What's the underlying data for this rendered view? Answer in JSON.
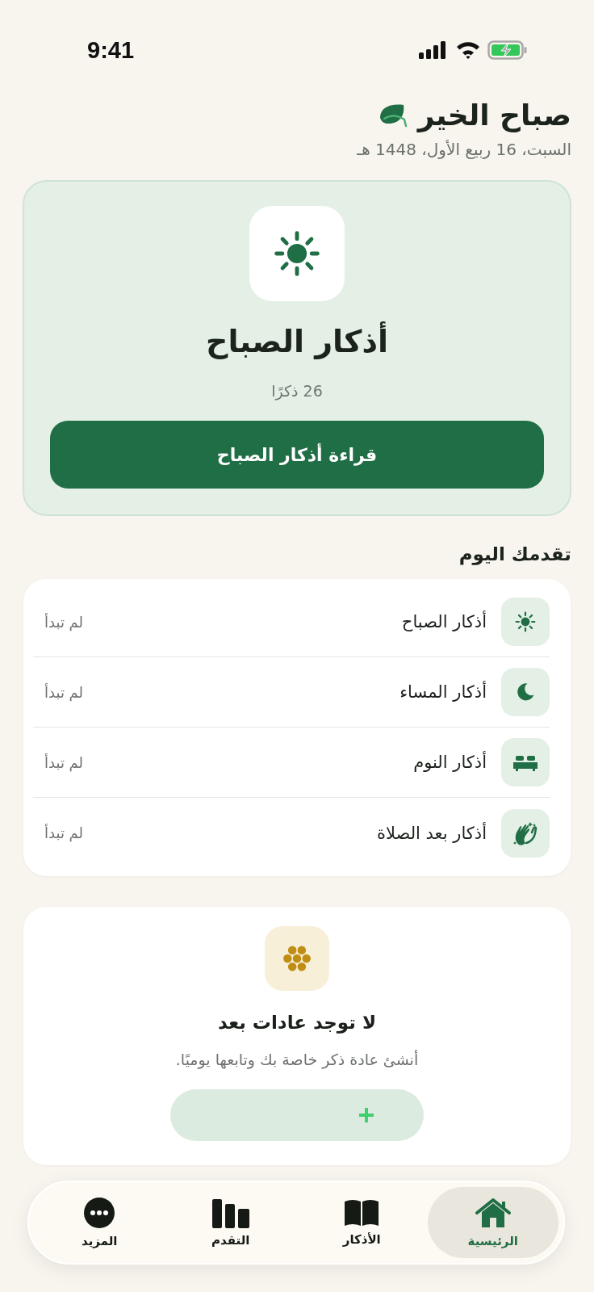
{
  "status_bar": {
    "time": "9:41"
  },
  "greeting": {
    "title": "صباح الخير",
    "date": "السبت، 16 ربيع الأول، 1448 هـ"
  },
  "hero": {
    "title": "أذكار الصباح",
    "count": "26 ذكرًا",
    "button": "قراءة أذكار الصباح"
  },
  "progress": {
    "heading": "تقدمك اليوم",
    "items": [
      {
        "title": "أذكار الصباح",
        "status": "لم تبدأ"
      },
      {
        "title": "أذكار المساء",
        "status": "لم تبدأ"
      },
      {
        "title": "أذكار النوم",
        "status": "لم تبدأ"
      },
      {
        "title": "أذكار بعد الصلاة",
        "status": "لم تبدأ"
      }
    ]
  },
  "habits": {
    "title": "لا توجد عادات بعد",
    "text": "أنشئ عادة ذكر خاصة بك وتابعها يوميًا."
  },
  "tabs": [
    {
      "label": "الرئيسية",
      "selected": true
    },
    {
      "label": "الأذكار",
      "selected": false
    },
    {
      "label": "التقدم",
      "selected": false
    },
    {
      "label": "المزيد",
      "selected": false
    }
  ]
}
